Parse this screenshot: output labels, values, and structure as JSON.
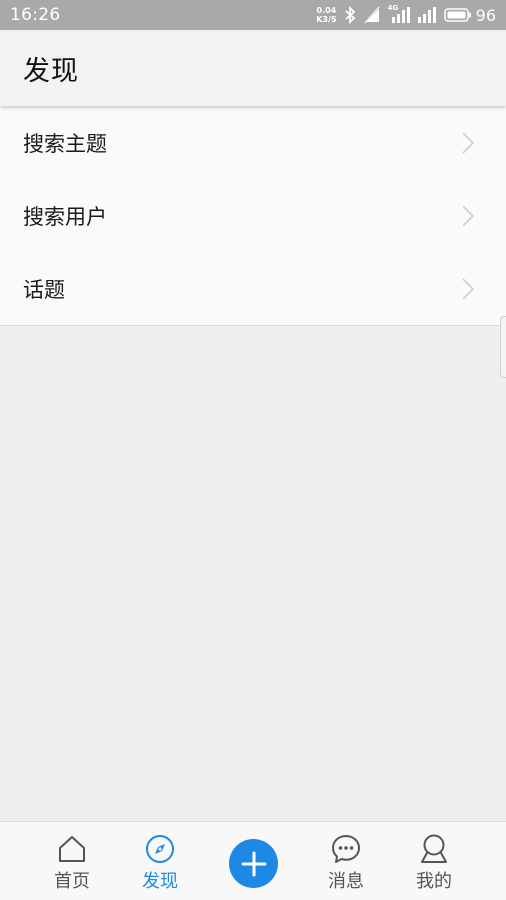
{
  "status_bar": {
    "time": "16:26",
    "net_speed_value": "0.04",
    "net_speed_unit": "K3/S",
    "signal_label": "4G",
    "battery": "96"
  },
  "header": {
    "title": "发现"
  },
  "menu": {
    "items": [
      {
        "label": "搜索主题"
      },
      {
        "label": "搜索用户"
      },
      {
        "label": "话题"
      }
    ]
  },
  "bottom_nav": {
    "items": [
      {
        "label": "首页",
        "icon": "home-icon",
        "active": false
      },
      {
        "label": "发现",
        "icon": "compass-icon",
        "active": true
      },
      {
        "label": "",
        "icon": "plus-icon",
        "active": false
      },
      {
        "label": "消息",
        "icon": "chat-icon",
        "active": false
      },
      {
        "label": "我的",
        "icon": "user-icon",
        "active": false
      }
    ]
  },
  "colors": {
    "accent": "#1e88e5",
    "status_bar": "#a9a9a9",
    "background": "#efefef"
  }
}
